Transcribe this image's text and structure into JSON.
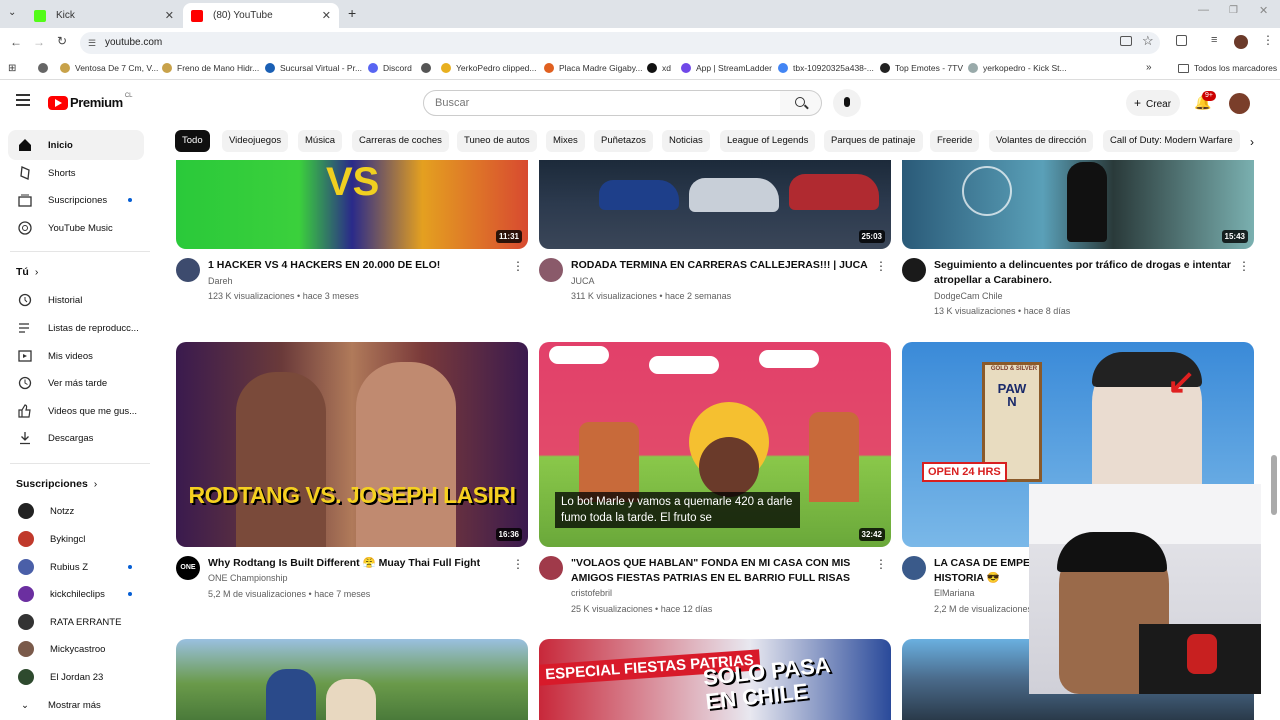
{
  "browser": {
    "tabs": [
      {
        "label": "Kick",
        "color": "#53fc18"
      },
      {
        "label": "(80) YouTube",
        "color": "#ff0000"
      }
    ],
    "url": "youtube.com",
    "bookmarks": [
      "Ventosa De 7 Cm, V...",
      "Freno de Mano Hidr...",
      "Sucursal Virtual - Pr...",
      "Discord",
      "YerkoPedro clipped...",
      "Placa Madre Gigaby...",
      "xd",
      "App | StreamLadder",
      "tbx-10920325a438-...",
      "Top Emotes - 7TV",
      "yerkopedro - Kick St...",
      "Todos los marcadores"
    ]
  },
  "header": {
    "logo": "Premium",
    "region": "CL",
    "search_placeholder": "Buscar",
    "create_label": "Crear",
    "notif_count": "9+"
  },
  "sidebar": {
    "main": [
      {
        "label": "Inicio",
        "icon": "home-icon"
      },
      {
        "label": "Shorts",
        "icon": "shorts-icon"
      },
      {
        "label": "Suscripciones",
        "icon": "subscriptions-icon"
      },
      {
        "label": "YouTube Music",
        "icon": "music-icon"
      }
    ],
    "you_title": "Tú",
    "you": [
      {
        "label": "Historial",
        "icon": "history-icon"
      },
      {
        "label": "Listas de reproducc...",
        "icon": "playlist-icon"
      },
      {
        "label": "Mis videos",
        "icon": "my-videos-icon"
      },
      {
        "label": "Ver más tarde",
        "icon": "watch-later-icon"
      },
      {
        "label": "Videos que me gus...",
        "icon": "like-icon"
      },
      {
        "label": "Descargas",
        "icon": "download-icon"
      }
    ],
    "subs_title": "Suscripciones",
    "subs": [
      {
        "label": "Notzz",
        "color": "#222"
      },
      {
        "label": "Bykingcl",
        "color": "#c0392b"
      },
      {
        "label": "Rubius Z",
        "color": "#4a5fa8"
      },
      {
        "label": "kickchileclips",
        "color": "#6b2fa0"
      },
      {
        "label": "RATA ERRANTE",
        "color": "#333"
      },
      {
        "label": "Mickycastroo",
        "color": "#7a5a4a"
      },
      {
        "label": "El Jordan 23",
        "color": "#2e4a2e"
      }
    ],
    "more_label": "Mostrar más"
  },
  "chips": [
    "Todo",
    "Videojuegos",
    "Música",
    "Carreras de coches",
    "Tuneo de autos",
    "Mixes",
    "Puñetazos",
    "Noticias",
    "League of Legends",
    "Parques de patinaje",
    "Freeride",
    "Volantes de dirección",
    "Call of Duty: Modern Warfare"
  ],
  "videos": [
    {
      "title": "1 HACKER VS 4 HACKERS EN 20.000 DE ELO!",
      "channel": "Dareh",
      "meta": "123 K visualizaciones • hace 3 meses",
      "duration": "11:31"
    },
    {
      "title": "RODADA TERMINA EN CARRERAS CALLEJERAS!!! | JUCA",
      "channel": "JUCA",
      "meta": "311 K visualizaciones • hace 2 semanas",
      "duration": "25:03"
    },
    {
      "title": "Seguimiento a delincuentes por tráfico de drogas e intentar atropellar a Carabinero.",
      "channel": "DodgeCam Chile",
      "meta": "13 K visualizaciones • hace 8 días",
      "duration": "15:43"
    },
    {
      "title": "Why Rodtang Is Built Different 😤 Muay Thai Full Fight",
      "channel": "ONE Championship",
      "meta": "5,2 M de visualizaciones • hace 7 meses",
      "duration": "16:36",
      "thumb_text": "RODTANG VS. JOSEPH LASIRI"
    },
    {
      "title": "\"VOLAOS QUE HABLAN\" FONDA EN MI CASA CON MIS AMIGOS FIESTAS PATRIAS EN EL BARRIO FULL RISAS",
      "channel": "cristofebril",
      "meta": "25 K visualizaciones • hace 12 días",
      "duration": "32:42",
      "caption": "Lo bot Marle y vamos a quemarle 420 a darle fumo toda la tarde. El fruto se"
    },
    {
      "title": "LA CASA DE EMPEÑ HISTORIA 😎",
      "channel": "ElMariana",
      "meta": "2,2 M de visualizaciones",
      "duration": "",
      "sign": "PAWN",
      "sign2": "OPEN 24 HRS",
      "sign3": "GOLD & SILVER"
    },
    {
      "title": "",
      "channel": "",
      "meta": "",
      "duration": ""
    },
    {
      "title": "",
      "channel": "",
      "meta": "",
      "duration": "",
      "thumb_text": "ESPECIAL FIESTAS PATRIAS",
      "thumb_text2": "SOLO PASA EN CHILE"
    },
    {
      "title": "",
      "channel": "",
      "meta": "",
      "duration": ""
    }
  ],
  "colors": {
    "youtube_red": "#ff0000",
    "chip_selected": "#0f0f0f",
    "subscription_dot": "#065fd4"
  }
}
